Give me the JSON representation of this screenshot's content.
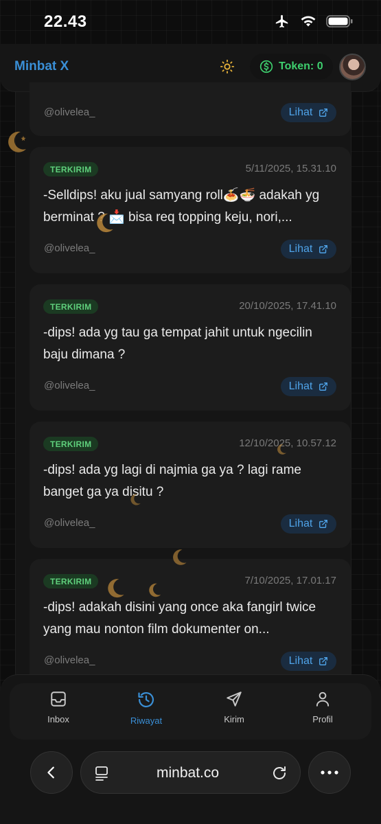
{
  "status_bar": {
    "time": "22.43"
  },
  "header": {
    "brand": "Minbat X",
    "token_label": "Token: 0"
  },
  "partial_card": {
    "username": "@olivelea_",
    "action_label": "Lihat"
  },
  "cards": [
    {
      "badge": "TERKIRIM",
      "date": "5/11/2025, 15.31.10",
      "text": "-Selldips! aku jual samyang roll🍝🍜 adakah yg berminat ? 📩 bisa req topping keju, nori,...",
      "username": "@olivelea_",
      "action_label": "Lihat"
    },
    {
      "badge": "TERKIRIM",
      "date": "20/10/2025, 17.41.10",
      "text": "-dips! ada yg tau ga tempat jahit untuk ngecilin baju dimana ?",
      "username": "@olivelea_",
      "action_label": "Lihat"
    },
    {
      "badge": "TERKIRIM",
      "date": "12/10/2025, 10.57.12",
      "text": "-dips! ada yg lagi di najmia ga ya ? lagi rame banget ga ya disitu ?",
      "username": "@olivelea_",
      "action_label": "Lihat"
    },
    {
      "badge": "TERKIRIM",
      "date": "7/10/2025, 17.01.17",
      "text": "-dips! adakah disini yang once aka fangirl twice yang mau nonton film dokumenter on...",
      "username": "@olivelea_",
      "action_label": "Lihat"
    }
  ],
  "bottom_nav": {
    "items": [
      {
        "label": "Inbox",
        "icon": "inbox-icon",
        "active": false
      },
      {
        "label": "Riwayat",
        "icon": "history-icon",
        "active": true
      },
      {
        "label": "Kirim",
        "icon": "send-icon",
        "active": false
      },
      {
        "label": "Profil",
        "icon": "user-icon",
        "active": false
      }
    ]
  },
  "browser": {
    "url": "minbat.co"
  },
  "colors": {
    "accent": "#3a8fd6",
    "success": "#3ecf6e",
    "badge_text": "#5fd07c",
    "moon": "#b8863a"
  }
}
